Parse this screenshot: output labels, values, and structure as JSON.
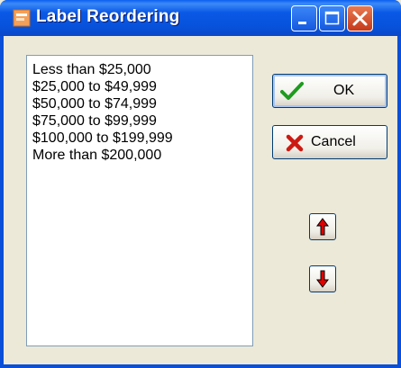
{
  "window": {
    "title": "Label Reordering"
  },
  "list": {
    "items": [
      "Less than $25,000",
      "$25,000 to $49,999",
      "$50,000 to $74,999",
      "$75,000 to $99,999",
      "$100,000 to $199,999",
      "More than $200,000"
    ]
  },
  "buttons": {
    "ok": "OK",
    "cancel": "Cancel"
  },
  "icons": {
    "app": "app-icon",
    "minimize": "minimize-icon",
    "maximize": "maximize-icon",
    "close": "close-icon",
    "ok": "checkmark-icon",
    "cancel": "x-icon",
    "move_up": "arrow-up-icon",
    "move_down": "arrow-down-icon"
  },
  "colors": {
    "titlebar": "#0a58e6",
    "close_button": "#c5391a",
    "check": "#1e9b1e",
    "x_mark": "#cc1a12",
    "arrows": "#e00000",
    "dialog_bg": "#ece9d8"
  }
}
